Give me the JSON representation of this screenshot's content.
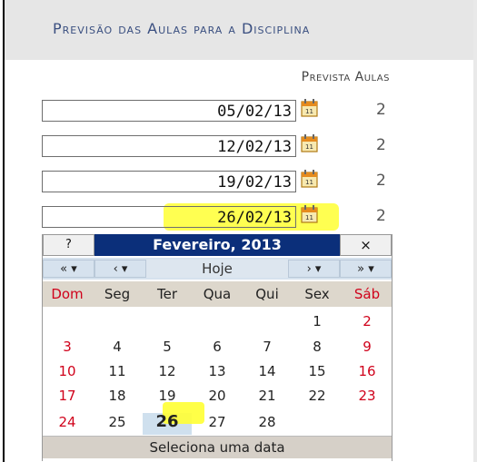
{
  "header": {
    "title": "Previsão das Aulas para a Disciplina"
  },
  "table": {
    "heading": "Prevista Aulas",
    "rows": [
      {
        "date": "05/02/13",
        "count": "2"
      },
      {
        "date": "12/02/13",
        "count": "2"
      },
      {
        "date": "19/02/13",
        "count": "2"
      },
      {
        "date": "26/02/13",
        "count": "2"
      }
    ]
  },
  "calendar": {
    "help": "?",
    "title": "Fevereiro, 2013",
    "close": "×",
    "nav": {
      "prev_year": "«",
      "prev_month": "‹",
      "today": "Hoje",
      "next_month": "›",
      "next_year": "»"
    },
    "weekdays": [
      "Dom",
      "Seg",
      "Ter",
      "Qua",
      "Qui",
      "Sex",
      "Sáb"
    ],
    "days": [
      "1",
      "2",
      "3",
      "4",
      "5",
      "6",
      "7",
      "8",
      "9",
      "10",
      "11",
      "12",
      "13",
      "14",
      "15",
      "16",
      "17",
      "18",
      "19",
      "20",
      "21",
      "22",
      "23",
      "24",
      "25",
      "26",
      "27",
      "28"
    ],
    "selected_day": "26",
    "footer": "Seleciona uma data"
  },
  "colors": {
    "header_bg": "#e6e6e6",
    "title": "#3a4f80",
    "calendar_title_bg": "#0b2f7a",
    "weekend": "#d0021b",
    "highlight": "#ffff33"
  }
}
